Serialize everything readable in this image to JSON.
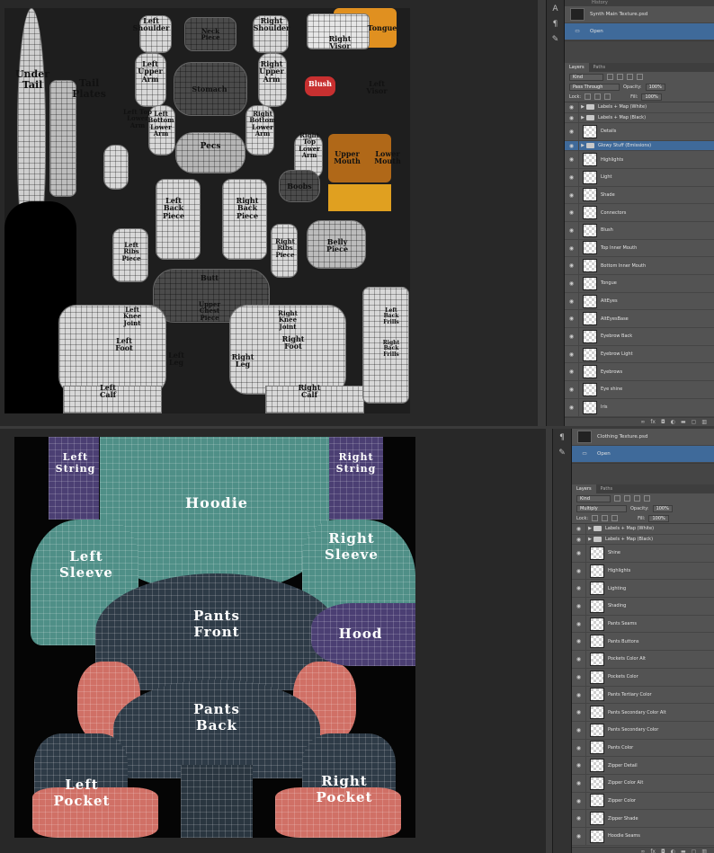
{
  "window1": {
    "history": {
      "doc_name": "Synth Main Texture.psd",
      "open_label": "Open"
    },
    "tabs": [
      "Layers",
      "Paths"
    ],
    "kind": "Kind",
    "blend_mode": "Pass Through",
    "opacity_label": "Opacity:",
    "opacity": "100%",
    "lock_label": "Lock:",
    "fill_label": "Fill:",
    "fill": "100%",
    "layers": [
      {
        "name": "Labels + Map (White)",
        "group": true
      },
      {
        "name": "Labels + Map (Black)",
        "group": true
      },
      {
        "name": "Details",
        "group": false
      },
      {
        "name": "Glowy Stuff (Emissions)",
        "group": true,
        "selected": true
      },
      {
        "name": "Highlights"
      },
      {
        "name": "Light"
      },
      {
        "name": "Shade"
      },
      {
        "name": "Connectors"
      },
      {
        "name": "Blush"
      },
      {
        "name": "Top Inner Mouth"
      },
      {
        "name": "Bottom Inner Mouth"
      },
      {
        "name": "Tongue"
      },
      {
        "name": "AltEyes"
      },
      {
        "name": "AltEyesBase"
      },
      {
        "name": "Eyebrow Back"
      },
      {
        "name": "Eyebrow Light"
      },
      {
        "name": "Eyebrows"
      },
      {
        "name": "Eye shine"
      },
      {
        "name": "Iris"
      }
    ],
    "uv_labels": [
      "Under Tail",
      "Tail Plates",
      "Left Shoulder",
      "Neck Piece",
      "Right Shoulder",
      "Tongue",
      "Left Upper Arm",
      "Right Visor",
      "Stomach",
      "Right Upper Arm",
      "Blush",
      "Left Visor",
      "Left Top Lower Arm",
      "Left Bottom Lower Arm",
      "Right Bottom Lower Arm",
      "Right Top Lower Arm",
      "Upper Mouth",
      "Lower Mouth",
      "Pecs",
      "Left Back Piece",
      "Right Back Piece",
      "Boobs",
      "Belly Piece",
      "Left Ribs Piece",
      "Right Ribs Piece",
      "Butt",
      "Left Knee Joint",
      "Right Knee Joint",
      "Upper Chest Piece",
      "Left Foot",
      "Right Foot",
      "Left Leg",
      "Right Leg",
      "Left Calf",
      "Right Calf",
      "Left Back Frills",
      "Right Back Frills",
      "Left Top Lower Arm"
    ]
  },
  "window2": {
    "history": {
      "doc_name": "Clothing Texture.psd",
      "open_label": "Open"
    },
    "tabs": [
      "Layers",
      "Paths"
    ],
    "kind": "Kind",
    "blend_mode": "Multiply",
    "opacity_label": "Opacity:",
    "opacity": "100%",
    "lock_label": "Lock:",
    "fill_label": "Fill:",
    "fill": "100%",
    "layers": [
      {
        "name": "Labels + Map (White)",
        "group": true
      },
      {
        "name": "Labels + Map (Black)",
        "group": true
      },
      {
        "name": "Shine"
      },
      {
        "name": "Highlights"
      },
      {
        "name": "Lighting"
      },
      {
        "name": "Shading"
      },
      {
        "name": "Pants Seams"
      },
      {
        "name": "Pants Buttons"
      },
      {
        "name": "Pockets Color Alt"
      },
      {
        "name": "Pockets Color"
      },
      {
        "name": "Pants Tertiary Color"
      },
      {
        "name": "Pants Secondary Color  Alt"
      },
      {
        "name": "Pants Secondary Color"
      },
      {
        "name": "Pants Color"
      },
      {
        "name": "Zipper Detail"
      },
      {
        "name": "Zipper Color Alt"
      },
      {
        "name": "Zipper Color"
      },
      {
        "name": "Zipper Shade"
      },
      {
        "name": "Hoodie Seams"
      }
    ],
    "cloth_labels": {
      "left_string": "Left String",
      "right_string": "Right String",
      "hoodie": "Hoodie",
      "left_sleeve": "Left Sleeve",
      "right_sleeve": "Right Sleeve",
      "pants_front": "Pants Front",
      "hood": "Hood",
      "pants_back": "Pants Back",
      "left_pocket": "Left Pocket",
      "right_pocket": "Right Pocket"
    }
  },
  "colors": {
    "teal": "#4f8f87",
    "navy": "#2e3b47",
    "salmon": "#d07066",
    "purple": "#4b3f73",
    "selection": "#3f6a9a"
  }
}
